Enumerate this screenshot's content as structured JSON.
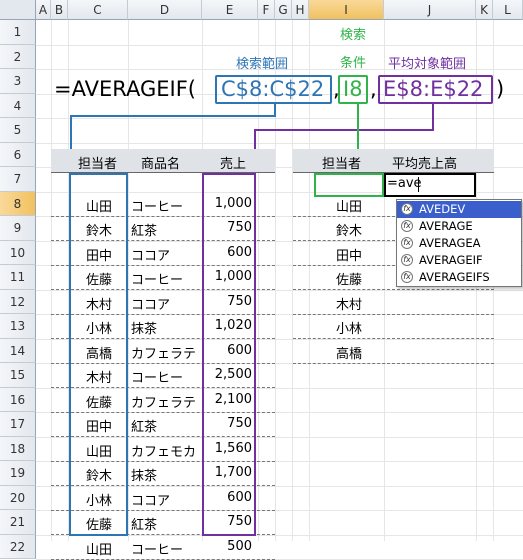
{
  "columns": [
    "A",
    "B",
    "C",
    "D",
    "E",
    "F",
    "G",
    "H",
    "I",
    "J",
    "K",
    "L"
  ],
  "rows": [
    "1",
    "2",
    "3",
    "4",
    "5",
    "6",
    "7",
    "8",
    "9",
    "10",
    "11",
    "12",
    "13",
    "14",
    "15",
    "16",
    "17",
    "18",
    "19",
    "20",
    "21",
    "22"
  ],
  "formula_display": {
    "prefix": "=AVERAGEIF(",
    "arg1": "C$8:C$22",
    "comma1": ",",
    "arg2": "I8",
    "comma2": ",",
    "arg3": "E$8:E$22",
    "suffix": ")"
  },
  "annotations": {
    "search_range": "検索範囲",
    "search_criteria_line1": "検索",
    "search_criteria_line2": "条件",
    "average_range": "平均対象範囲"
  },
  "colors": {
    "blue": "#2e75b6",
    "green": "#2fb34a",
    "purple": "#7030a0",
    "header_band": "#dfe3e8",
    "autocomplete_highlight": "#3a5fcd"
  },
  "left_table": {
    "headers": [
      "担当者",
      "商品名",
      "売上"
    ],
    "rows": [
      [
        "山田",
        "コーヒー",
        "1,000"
      ],
      [
        "鈴木",
        "紅茶",
        "750"
      ],
      [
        "田中",
        "ココア",
        "600"
      ],
      [
        "佐藤",
        "コーヒー",
        "1,000"
      ],
      [
        "木村",
        "ココア",
        "750"
      ],
      [
        "小林",
        "抹茶",
        "1,020"
      ],
      [
        "高橋",
        "カフェラテ",
        "600"
      ],
      [
        "木村",
        "コーヒー",
        "2,500"
      ],
      [
        "佐藤",
        "カフェラテ",
        "2,100"
      ],
      [
        "田中",
        "紅茶",
        "750"
      ],
      [
        "山田",
        "カフェモカ",
        "1,560"
      ],
      [
        "鈴木",
        "抹茶",
        "1,700"
      ],
      [
        "小林",
        "ココア",
        "600"
      ],
      [
        "佐藤",
        "紅茶",
        "750"
      ],
      [
        "山田",
        "コーヒー",
        "500"
      ]
    ]
  },
  "right_table": {
    "headers": [
      "担当者",
      "平均売上高"
    ],
    "persons": [
      "山田",
      "鈴木",
      "田中",
      "佐藤",
      "木村",
      "小林",
      "高橋"
    ],
    "editing_text": "=ave"
  },
  "autocomplete": {
    "items": [
      "AVEDEV",
      "AVERAGE",
      "AVERAGEA",
      "AVERAGEIF",
      "AVERAGEIFS"
    ],
    "selected_index": 0
  }
}
